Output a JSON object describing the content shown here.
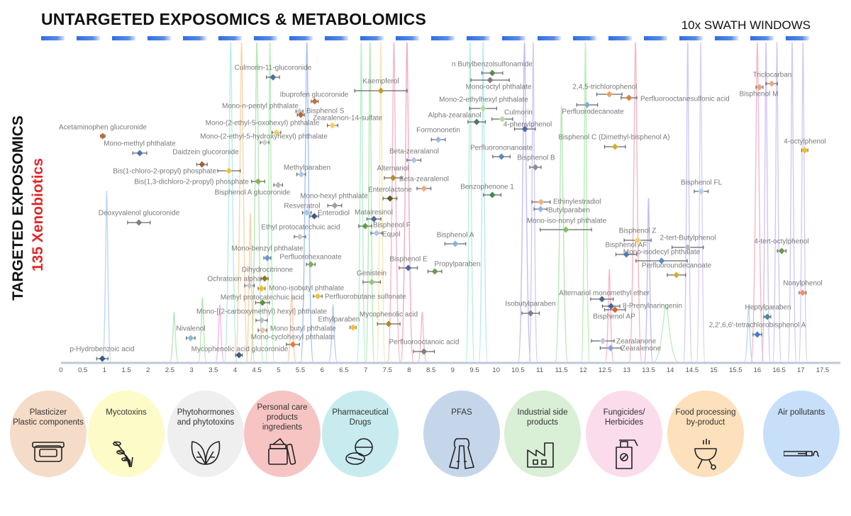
{
  "header": {
    "title": "UNTARGETED EXPOSOMICS & METABOLOMICS",
    "swath_label": "10x SWATH WINDOWS",
    "swath_bar_color": "#2f6fe0"
  },
  "side": {
    "title": "TARGETED EXPOSOMICS",
    "subtitle": "135 Xenobiotics",
    "subtitle_color": "#e0282a"
  },
  "chart_data": {
    "type": "scatter",
    "title": "",
    "xlabel": "",
    "ylabel": "",
    "xlim": [
      0,
      17.5
    ],
    "x_ticks": [
      "0",
      "0.5",
      "1",
      "1.5",
      "2",
      "2.5",
      "3",
      "3.5",
      "4",
      "4.5",
      "5",
      "5.5",
      "6",
      "6.5",
      "7",
      "7.5",
      "8",
      "8.5",
      "9",
      "9.5",
      "10",
      "10.5",
      "11",
      "11.5",
      "12",
      "12.5",
      "13",
      "13.5",
      "14",
      "14.5",
      "15",
      "15.5",
      "16",
      "16.5",
      "17",
      "17.5"
    ],
    "grid": false,
    "background": "overlaid chromatogram traces",
    "points": [
      {
        "name": "Culmorin-11-glucoronide",
        "rt": 4.87,
        "err": 0.15,
        "color": "#4a6e9a"
      },
      {
        "name": "Ibuprofen glucoronide",
        "rt": 5.83,
        "err": 0.08,
        "color": "#c07040"
      },
      {
        "name": "Mono-n-pentyl phthalate",
        "rt": 5.48,
        "err": 0.08,
        "color": "#c8c8c8"
      },
      {
        "name": "Bisphenol S",
        "rt": 5.51,
        "err": 0.08,
        "color": "#b86a3a"
      },
      {
        "name": "Zearalenon-14-sulfate",
        "rt": 6.24,
        "err": 0.12,
        "color": "#f0d060"
      },
      {
        "name": "Mono-(2-ethyl-5-oxohexyl) phthalate",
        "rt": 4.95,
        "err": 0.1,
        "color": "#f0d060"
      },
      {
        "name": "Mono-(2-ethyl-5-hydroxyhexyl) phthalate",
        "rt": 4.68,
        "err": 0.1,
        "color": "#d0d0d0"
      },
      {
        "name": "Acetaminophen glucuronide",
        "rt": 0.96,
        "err": 0.05,
        "color": "#b87040"
      },
      {
        "name": "Mono-methyl phthalate",
        "rt": 1.81,
        "err": 0.16,
        "color": "#4a78b0"
      },
      {
        "name": "Daidzein glucoronide",
        "rt": 3.24,
        "err": 0.12,
        "color": "#a06040"
      },
      {
        "name": "Bis(1-chloro-2-propyl) phosphate",
        "rt": 3.86,
        "err": 0.26,
        "color": "#f0c040"
      },
      {
        "name": "Bis(1,3-dichloro-2-propyl) phosphate",
        "rt": 4.53,
        "err": 0.15,
        "color": "#8ab060"
      },
      {
        "name": "Bisphenol A glucoronide",
        "rt": 4.99,
        "err": 0.1,
        "color": "#b8b8b8"
      },
      {
        "name": "Methylparaben",
        "rt": 5.52,
        "err": 0.1,
        "color": "#a8c8e8"
      },
      {
        "name": "n Butylbenzolsulfonamide",
        "rt": 9.91,
        "err": 0.24,
        "color": "#5a8a50"
      },
      {
        "name": "Mono-octyl phthalate",
        "rt": 9.86,
        "err": 0.44,
        "color": "#808080"
      },
      {
        "name": "Kaempferol",
        "rt": 7.35,
        "err": 0.6,
        "color": "#b8a030"
      },
      {
        "name": "Mono-2-ethylhexyl phthalate",
        "rt": 9.7,
        "err": 0.31,
        "color": "#b8d8a0"
      },
      {
        "name": "Alpha-zearalanol",
        "rt": 9.55,
        "err": 0.2,
        "color": "#4a7a60"
      },
      {
        "name": "Culmorin",
        "rt": 10.14,
        "err": 0.24,
        "color": "#b8d8a0"
      },
      {
        "name": "4-phenylphenol",
        "rt": 10.66,
        "err": 0.24,
        "color": "#4a6ab0"
      },
      {
        "name": "Formononetin",
        "rt": 8.67,
        "err": 0.16,
        "color": "#a0b8e0"
      },
      {
        "name": "Perfluorononanoate",
        "rt": 10.12,
        "err": 0.2,
        "color": "#5a8ac0"
      },
      {
        "name": "Beta-zearalanol",
        "rt": 8.11,
        "err": 0.16,
        "color": "#a8c8e8"
      },
      {
        "name": "Bisphenol B",
        "rt": 10.9,
        "err": 0.13,
        "color": "#909090"
      },
      {
        "name": "Alternariol",
        "rt": 7.63,
        "err": 0.2,
        "color": "#b09030"
      },
      {
        "name": "Beta-zearalenol",
        "rt": 8.34,
        "err": 0.16,
        "color": "#f0a880"
      },
      {
        "name": "Enterolactone",
        "rt": 7.56,
        "err": 0.16,
        "color": "#5a5a20"
      },
      {
        "name": "Benzophenone 1",
        "rt": 9.91,
        "err": 0.2,
        "color": "#4a8a50"
      },
      {
        "name": "Perfluorodecanoate",
        "rt": 12.09,
        "err": 0.24,
        "color": "#8aa8d8"
      },
      {
        "name": "2,4,5-trichlorophenol",
        "rt": 12.6,
        "err": 0.29,
        "color": "#f0a060"
      },
      {
        "name": "Perfluorooctanesulfonic acid",
        "rt": 13.05,
        "err": 0.18,
        "color": "#d88040"
      },
      {
        "name": "Bisphenol C (Dimethyl-bisphenol A)",
        "rt": 12.73,
        "err": 0.24,
        "color": "#d0b030"
      },
      {
        "name": "Ethinylestradiol",
        "rt": 11.03,
        "err": 0.21,
        "color": "#f0b080"
      },
      {
        "name": "Butylparaben",
        "rt": 11.02,
        "err": 0.15,
        "color": "#a0b0e0"
      },
      {
        "name": "Triclocarban",
        "rt": 16.33,
        "err": 0.13,
        "color": "#f0a880"
      },
      {
        "name": "Bisphenol M",
        "rt": 16.05,
        "err": 0.08,
        "color": "#f0a080"
      },
      {
        "name": "4-octylphenol",
        "rt": 17.09,
        "err": 0.07,
        "color": "#f0c020"
      },
      {
        "name": "Bisphenol FL",
        "rt": 14.71,
        "err": 0.16,
        "color": "#b0d0f0"
      },
      {
        "name": "Matairesinol",
        "rt": 7.19,
        "err": 0.16,
        "color": "#4a6a9a"
      },
      {
        "name": "Bisphenol F",
        "rt": 6.99,
        "err": 0.15,
        "color": "#6a9a50"
      },
      {
        "name": "Equol",
        "rt": 7.25,
        "err": 0.13,
        "color": "#a8c8f0"
      },
      {
        "name": "Bisphenol A",
        "rt": 9.06,
        "err": 0.24,
        "color": "#8ab0e0"
      },
      {
        "name": "Mono-iso-nonyl phthalate",
        "rt": 11.6,
        "err": 0.59,
        "color": "#80c060"
      },
      {
        "name": "Bisphenol E",
        "rt": 7.98,
        "err": 0.21,
        "color": "#4a6aa0"
      },
      {
        "name": "Propylparaben",
        "rt": 8.59,
        "err": 0.16,
        "color": "#6a9a50"
      },
      {
        "name": "Genistein",
        "rt": 7.14,
        "err": 0.2,
        "color": "#90c880"
      },
      {
        "name": "Isobutylparaben",
        "rt": 10.79,
        "err": 0.2,
        "color": "#808080"
      },
      {
        "name": "Mycophenolic acid",
        "rt": 7.53,
        "err": 0.26,
        "color": "#b08a30"
      },
      {
        "name": "Ethylparaben",
        "rt": 6.71,
        "err": 0.07,
        "color": "#f0c040"
      },
      {
        "name": "Perfluorooctanoic acid",
        "rt": 8.34,
        "err": 0.24,
        "color": "#808080"
      },
      {
        "name": "Bisphenol Z",
        "rt": 13.25,
        "err": 0.31,
        "color": "#f0d060"
      },
      {
        "name": "2-tert-Butylphenol",
        "rt": 14.4,
        "err": 0.36,
        "color": "#b8b8b8"
      },
      {
        "name": "Bisphenol AF",
        "rt": 12.99,
        "err": 0.24,
        "color": "#4a7ac0"
      },
      {
        "name": "Mono-isodecyl phthalate",
        "rt": 13.8,
        "err": 0.59,
        "color": "#5a8ad0"
      },
      {
        "name": "Perfluoroundecanoate",
        "rt": 14.14,
        "err": 0.21,
        "color": "#d0b030"
      },
      {
        "name": "4-tert-octylphenol",
        "rt": 16.56,
        "err": 0.1,
        "color": "#6a9a50"
      },
      {
        "name": "Nonylphenol",
        "rt": 17.04,
        "err": 0.08,
        "color": "#f09070"
      },
      {
        "name": "Alternariol monomethyl ether",
        "rt": 12.43,
        "err": 0.26,
        "color": "#4a6a8a"
      },
      {
        "name": "8-Prenylnaringenin",
        "rt": 12.64,
        "err": 0.2,
        "color": "#3a6a9a"
      },
      {
        "name": "Bisphenol AP",
        "rt": 12.73,
        "err": 0.24,
        "color": "#e06030"
      },
      {
        "name": "Heptylparaben",
        "rt": 16.23,
        "err": 0.08,
        "color": "#4a8a9a"
      },
      {
        "name": "2,2′,6,6′-tetrachlorobisphenol A",
        "rt": 16.0,
        "err": 0.1,
        "color": "#4a7ad0"
      },
      {
        "name": "Zearalanone",
        "rt": 12.45,
        "err": 0.26,
        "color": "#c0c8e0"
      },
      {
        "name": "Zearalenone",
        "rt": 12.63,
        "err": 0.24,
        "color": "#8aa0e0"
      },
      {
        "name": "Deoxyvalenol glucoronide",
        "rt": 1.79,
        "err": 0.26,
        "color": "#808080"
      },
      {
        "name": "Resveratrol",
        "rt": 5.65,
        "err": 0.1,
        "color": "#a8c8e8"
      },
      {
        "name": "Mono-hexyl phthalate",
        "rt": 6.29,
        "err": 0.16,
        "color": "#a0a0a0"
      },
      {
        "name": "Enterodiol",
        "rt": 5.82,
        "err": 0.1,
        "color": "#3a5a8a"
      },
      {
        "name": "Ethyl protocatechuic acid",
        "rt": 5.49,
        "err": 0.13,
        "color": "#c8c8c8"
      },
      {
        "name": "Mono-benzyl phthalate",
        "rt": 4.74,
        "err": 0.08,
        "color": "#6a9ad0"
      },
      {
        "name": "Perfluorohexanoate",
        "rt": 5.74,
        "err": 0.1,
        "color": "#80b060"
      },
      {
        "name": "Dihydrocitrinone",
        "rt": 4.68,
        "err": 0.08,
        "color": "#8a7a20"
      },
      {
        "name": "Ochratoxin alpha",
        "rt": 4.33,
        "err": 0.11,
        "color": "#c8c8c8"
      },
      {
        "name": "Mono-isobutyl phthalate",
        "rt": 4.61,
        "err": 0.08,
        "color": "#f0c020"
      },
      {
        "name": "Perfluorobutane sulfonate",
        "rt": 5.9,
        "err": 0.1,
        "color": "#f0c040"
      },
      {
        "name": "Methyl protocatechuic acid",
        "rt": 4.63,
        "err": 0.16,
        "color": "#6a8a40"
      },
      {
        "name": "Mono-[(2-carboxymethyl) hexyl] phthalate",
        "rt": 4.61,
        "err": 0.13,
        "color": "#b8c0c8"
      },
      {
        "name": "Nivalenol",
        "rt": 2.98,
        "err": 0.1,
        "color": "#90b8e0"
      },
      {
        "name": "Mono butyl phthalate",
        "rt": 4.63,
        "err": 0.1,
        "color": "#f0c0a0"
      },
      {
        "name": "Mono-cyclohexyl phthalate",
        "rt": 5.33,
        "err": 0.15,
        "color": "#e08040"
      },
      {
        "name": "Mycophenolic acid glucoronide",
        "rt": 4.09,
        "err": 0.08,
        "color": "#3a5a8a"
      },
      {
        "name": "p-Hydrobenzoic acid",
        "rt": 0.95,
        "err": 0.13,
        "color": "#3a5a8a"
      }
    ]
  },
  "categories": [
    {
      "label": "Plasticizer\nPlastic components",
      "icon": "food-container-icon",
      "color": "#f5dcc8"
    },
    {
      "label": "Mycotoxins",
      "icon": "wheat-icon",
      "color": "#fdfbc8"
    },
    {
      "label": "Phytohormones\nand phytotoxins",
      "icon": "leaves-icon",
      "color": "#efefef"
    },
    {
      "label": "Personal care\nproducts\ningredients",
      "icon": "cream-jar-icon",
      "color": "#f7c4c4"
    },
    {
      "label": "Pharmaceutical\nDrugs",
      "icon": "pills-icon",
      "color": "#c8ebef"
    },
    {
      "label": "PFAS",
      "icon": "raincoat-icon",
      "color": "#c6d6ea"
    },
    {
      "label": "Industrial side\nproducts",
      "icon": "factory-icon",
      "color": "#d9efd6"
    },
    {
      "label": "Fungicides/\nHerbicides",
      "icon": "spray-bottle-icon",
      "color": "#fbdcec"
    },
    {
      "label": "Food processing\nby-product",
      "icon": "grill-icon",
      "color": "#fde0bc"
    },
    {
      "label": "Air pollutants",
      "icon": "cigarette-icon",
      "color": "#c8dffa"
    }
  ]
}
